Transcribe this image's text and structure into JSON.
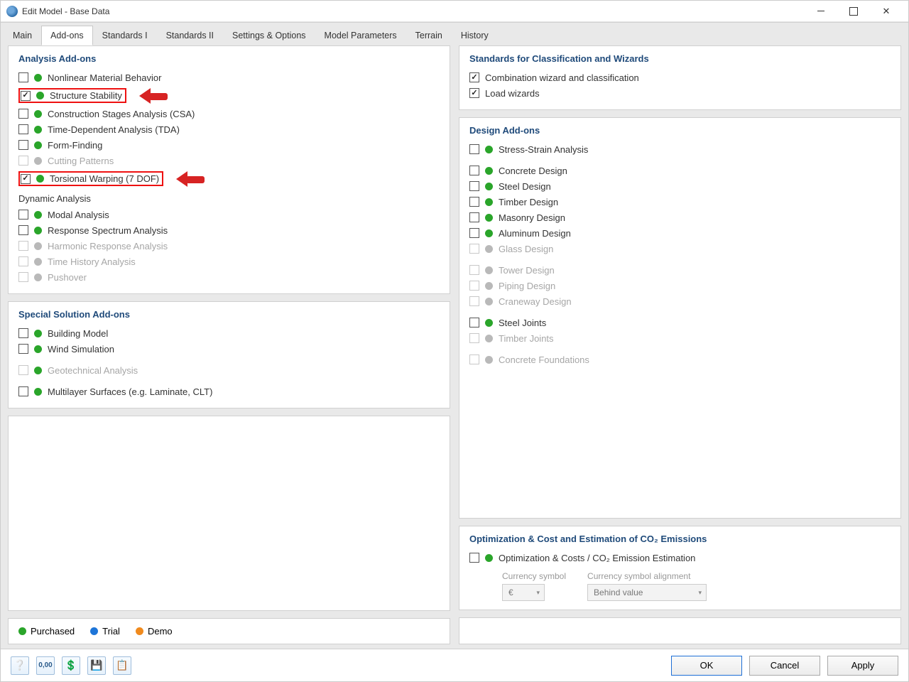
{
  "window": {
    "title": "Edit Model - Base Data"
  },
  "tabs": [
    "Main",
    "Add-ons",
    "Standards I",
    "Standards II",
    "Settings & Options",
    "Model Parameters",
    "Terrain",
    "History"
  ],
  "active_tab": "Add-ons",
  "left": {
    "analysis": {
      "title": "Analysis Add-ons",
      "items": [
        {
          "label": "Nonlinear Material Behavior",
          "checked": false,
          "dot": "green",
          "enabled": true,
          "highlight": false
        },
        {
          "label": "Structure Stability",
          "checked": true,
          "dot": "green",
          "enabled": true,
          "highlight": true
        },
        {
          "label": "Construction Stages Analysis (CSA)",
          "checked": false,
          "dot": "green",
          "enabled": true,
          "highlight": false
        },
        {
          "label": "Time-Dependent Analysis (TDA)",
          "checked": false,
          "dot": "green",
          "enabled": true,
          "highlight": false
        },
        {
          "label": "Form-Finding",
          "checked": false,
          "dot": "green",
          "enabled": true,
          "highlight": false
        },
        {
          "label": "Cutting Patterns",
          "checked": false,
          "dot": "grey",
          "enabled": false,
          "highlight": false
        },
        {
          "label": "Torsional Warping (7 DOF)",
          "checked": true,
          "dot": "green",
          "enabled": true,
          "highlight": true
        }
      ],
      "dynamic_title": "Dynamic Analysis",
      "dynamic": [
        {
          "label": "Modal Analysis",
          "checked": false,
          "dot": "green",
          "enabled": true
        },
        {
          "label": "Response Spectrum Analysis",
          "checked": false,
          "dot": "green",
          "enabled": true
        },
        {
          "label": "Harmonic Response Analysis",
          "checked": false,
          "dot": "grey",
          "enabled": false
        },
        {
          "label": "Time History Analysis",
          "checked": false,
          "dot": "grey",
          "enabled": false
        },
        {
          "label": "Pushover",
          "checked": false,
          "dot": "grey",
          "enabled": false
        }
      ]
    },
    "special": {
      "title": "Special Solution Add-ons",
      "items": [
        {
          "label": "Building Model",
          "checked": false,
          "dot": "green",
          "enabled": true
        },
        {
          "label": "Wind Simulation",
          "checked": false,
          "dot": "green",
          "enabled": true
        },
        {
          "label": "Geotechnical Analysis",
          "checked": false,
          "dot": "green",
          "enabled": false
        },
        {
          "label": "Multilayer Surfaces (e.g. Laminate, CLT)",
          "checked": false,
          "dot": "green",
          "enabled": true
        }
      ]
    }
  },
  "right": {
    "standards": {
      "title": "Standards for Classification and Wizards",
      "items": [
        {
          "label": "Combination wizard and classification",
          "checked": true,
          "enabled": true
        },
        {
          "label": "Load wizards",
          "checked": true,
          "enabled": true
        }
      ]
    },
    "design": {
      "title": "Design Add-ons",
      "items": [
        {
          "label": "Stress-Strain Analysis",
          "dot": "green",
          "enabled": true,
          "gapafter": true
        },
        {
          "label": "Concrete Design",
          "dot": "green",
          "enabled": true
        },
        {
          "label": "Steel Design",
          "dot": "green",
          "enabled": true
        },
        {
          "label": "Timber Design",
          "dot": "green",
          "enabled": true
        },
        {
          "label": "Masonry Design",
          "dot": "green",
          "enabled": true
        },
        {
          "label": "Aluminum Design",
          "dot": "green",
          "enabled": true
        },
        {
          "label": "Glass Design",
          "dot": "grey",
          "enabled": false,
          "gapafter": true
        },
        {
          "label": "Tower Design",
          "dot": "grey",
          "enabled": false
        },
        {
          "label": "Piping Design",
          "dot": "grey",
          "enabled": false
        },
        {
          "label": "Craneway Design",
          "dot": "grey",
          "enabled": false,
          "gapafter": true
        },
        {
          "label": "Steel Joints",
          "dot": "green",
          "enabled": true
        },
        {
          "label": "Timber Joints",
          "dot": "grey",
          "enabled": false,
          "gapafter": true
        },
        {
          "label": "Concrete Foundations",
          "dot": "grey",
          "enabled": false
        }
      ]
    },
    "opt": {
      "title": "Optimization & Cost and Estimation of CO₂ Emissions",
      "item": {
        "label": "Optimization & Costs / CO₂ Emission Estimation",
        "dot": "green",
        "enabled": true,
        "checked": false
      },
      "currency_label": "Currency symbol",
      "currency_value": "€",
      "align_label": "Currency symbol alignment",
      "align_value": "Behind value"
    }
  },
  "legend": {
    "purchased": "Purchased",
    "trial": "Trial",
    "demo": "Demo"
  },
  "footer": {
    "ok": "OK",
    "cancel": "Cancel",
    "apply": "Apply"
  }
}
